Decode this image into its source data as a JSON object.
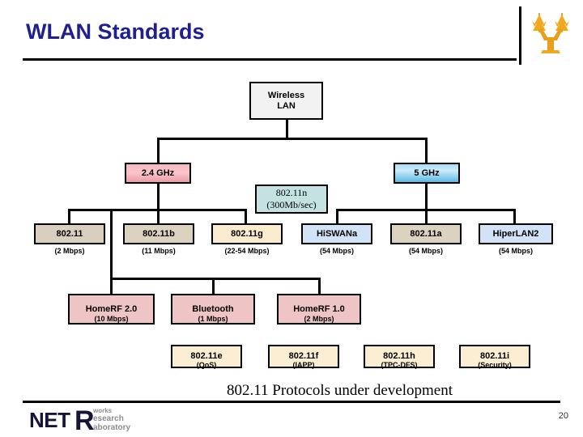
{
  "header": {
    "title": "WLAN Standards",
    "logo_icon": "tree-logo-icon"
  },
  "diagram": {
    "root": {
      "line1": "Wireless",
      "line2": "LAN"
    },
    "bands": [
      {
        "label": "2.4 GHz",
        "color": "#f4a7ae"
      },
      {
        "label": "5 GHz",
        "color": "#7fc9ea"
      }
    ],
    "dotn": {
      "line1": "802.11n",
      "line2": "(300Mb/sec)"
    },
    "protocols": [
      {
        "name": "802.11",
        "rate": "(2 Mbps)",
        "color": "#d8cfbe"
      },
      {
        "name": "802.11b",
        "rate": "(11 Mbps)",
        "color": "#dcd2c0"
      },
      {
        "name": "802.11g",
        "rate": "(22-54 Mbps)",
        "color": "#fbecd0"
      },
      {
        "name": "HiSWANa",
        "rate": "(54 Mbps)",
        "color": "#d3e3f7"
      },
      {
        "name": "802.11a",
        "rate": "(54 Mbps)",
        "color": "#dcd2c0"
      },
      {
        "name": "HiperLAN2",
        "rate": "(54 Mbps)",
        "color": "#d3e3f7"
      }
    ],
    "home_row": [
      {
        "name": "HomeRF 2.0",
        "rate": "(10 Mbps)",
        "color": "#eec4c4"
      },
      {
        "name": "Bluetooth",
        "rate": "(1 Mbps)",
        "color": "#eec4c4"
      },
      {
        "name": "HomeRF 1.0",
        "rate": "(2 Mbps)",
        "color": "#eec4c4"
      }
    ],
    "dev_row": [
      {
        "name": "802.11e",
        "rate": "(QoS)",
        "color": "#fbeed2"
      },
      {
        "name": "802.11f",
        "rate": "(IAPP)",
        "color": "#fbeed2"
      },
      {
        "name": "802.11h",
        "rate": "(TPC-DFS)",
        "color": "#fbeed2"
      },
      {
        "name": "802.11i",
        "rate": "(Security)",
        "color": "#fbeed2"
      }
    ]
  },
  "footer": {
    "caption": "802.11 Protocols under development",
    "page_number": "20",
    "logo": {
      "net": "NET",
      "r": "R",
      "works": "works",
      "research": "esearch",
      "laboratory": "aboratory"
    }
  }
}
